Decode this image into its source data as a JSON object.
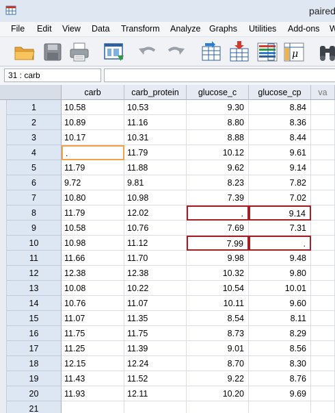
{
  "window": {
    "title": "paired"
  },
  "menu": [
    "File",
    "Edit",
    "View",
    "Data",
    "Transform",
    "Analyze",
    "Graphs",
    "Utilities",
    "Add-ons",
    "W"
  ],
  "toolbar": [
    "open-folder-icon",
    "save-icon",
    "print-icon",
    "dialog-recall-icon",
    "undo-icon",
    "redo-icon",
    "goto-case-icon",
    "goto-variable-icon",
    "variables-icon",
    "value-labels-icon",
    "binoculars-icon"
  ],
  "cell_editor": {
    "reference": "31 : carb",
    "value": ""
  },
  "columns": [
    "carb",
    "carb_protein",
    "glucose_c",
    "glucose_cp",
    "va"
  ],
  "rows": [
    {
      "n": "1",
      "carb": "10.58",
      "carb_protein": "10.53",
      "glucose_c": "9.30",
      "glucose_cp": "8.84"
    },
    {
      "n": "2",
      "carb": "10.89",
      "carb_protein": "11.16",
      "glucose_c": "8.80",
      "glucose_cp": "8.36"
    },
    {
      "n": "3",
      "carb": "10.17",
      "carb_protein": "10.31",
      "glucose_c": "8.88",
      "glucose_cp": "8.44"
    },
    {
      "n": "4",
      "carb": ".",
      "carb_protein": "11.79",
      "glucose_c": "10.12",
      "glucose_cp": "9.61"
    },
    {
      "n": "5",
      "carb": "11.79",
      "carb_protein": "11.88",
      "glucose_c": "9.62",
      "glucose_cp": "9.14"
    },
    {
      "n": "6",
      "carb": "9.72",
      "carb_protein": "9.81",
      "glucose_c": "8.23",
      "glucose_cp": "7.82"
    },
    {
      "n": "7",
      "carb": "10.80",
      "carb_protein": "10.98",
      "glucose_c": "7.39",
      "glucose_cp": "7.02"
    },
    {
      "n": "8",
      "carb": "11.79",
      "carb_protein": "12.02",
      "glucose_c": ".",
      "glucose_cp": "9.14"
    },
    {
      "n": "9",
      "carb": "10.58",
      "carb_protein": "10.76",
      "glucose_c": "7.69",
      "glucose_cp": "7.31"
    },
    {
      "n": "10",
      "carb": "10.98",
      "carb_protein": "11.12",
      "glucose_c": "7.99",
      "glucose_cp": "."
    },
    {
      "n": "11",
      "carb": "11.66",
      "carb_protein": "11.70",
      "glucose_c": "9.98",
      "glucose_cp": "9.48"
    },
    {
      "n": "12",
      "carb": "12.38",
      "carb_protein": "12.38",
      "glucose_c": "10.32",
      "glucose_cp": "9.80"
    },
    {
      "n": "13",
      "carb": "10.08",
      "carb_protein": "10.22",
      "glucose_c": "10.54",
      "glucose_cp": "10.01"
    },
    {
      "n": "14",
      "carb": "10.76",
      "carb_protein": "11.07",
      "glucose_c": "10.11",
      "glucose_cp": "9.60"
    },
    {
      "n": "15",
      "carb": "11.07",
      "carb_protein": "11.35",
      "glucose_c": "8.54",
      "glucose_cp": "8.11"
    },
    {
      "n": "16",
      "carb": "11.75",
      "carb_protein": "11.75",
      "glucose_c": "8.73",
      "glucose_cp": "8.29"
    },
    {
      "n": "17",
      "carb": "11.25",
      "carb_protein": "11.39",
      "glucose_c": "9.01",
      "glucose_cp": "8.56"
    },
    {
      "n": "18",
      "carb": "12.15",
      "carb_protein": "12.24",
      "glucose_c": "8.70",
      "glucose_cp": "8.30"
    },
    {
      "n": "19",
      "carb": "11.43",
      "carb_protein": "11.52",
      "glucose_c": "9.22",
      "glucose_cp": "8.76"
    },
    {
      "n": "20",
      "carb": "11.93",
      "carb_protein": "12.11",
      "glucose_c": "10.20",
      "glucose_cp": "9.69"
    },
    {
      "n": "21",
      "carb": "",
      "carb_protein": "",
      "glucose_c": "",
      "glucose_cp": ""
    }
  ],
  "highlights": [
    {
      "row": "4",
      "column": "carb",
      "color": "#f0a24a"
    },
    {
      "row": "8",
      "column": "glucose_c",
      "color": "#a31f23"
    },
    {
      "row": "8",
      "column": "glucose_cp",
      "color": "#a31f23"
    },
    {
      "row": "10",
      "column": "glucose_c",
      "color": "#a31f23"
    },
    {
      "row": "10",
      "column": "glucose_cp",
      "color": "#a31f23"
    }
  ]
}
